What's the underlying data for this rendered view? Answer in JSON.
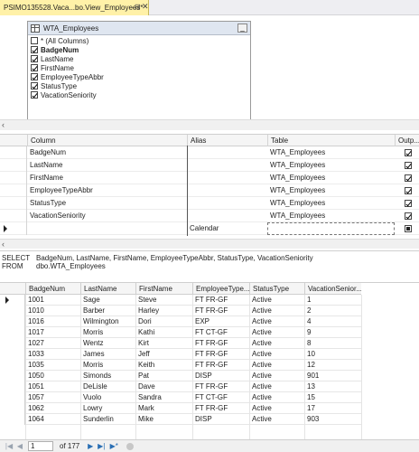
{
  "tab": {
    "title": "PSIMO135528.Vaca...bo.View_Employees*",
    "pin_icon": "pin-icon",
    "close_icon": "close-icon"
  },
  "diagram": {
    "table_name": "WTA_Employees",
    "columns": [
      {
        "label": "* (All Columns)",
        "checked": false,
        "bold": false
      },
      {
        "label": "BadgeNum",
        "checked": true,
        "bold": true
      },
      {
        "label": "LastName",
        "checked": true,
        "bold": false
      },
      {
        "label": "FirstName",
        "checked": true,
        "bold": false
      },
      {
        "label": "EmployeeTypeAbbr",
        "checked": true,
        "bold": false
      },
      {
        "label": "StatusType",
        "checked": true,
        "bold": false
      },
      {
        "label": "VacationSeniority",
        "checked": true,
        "bold": false
      }
    ],
    "minimize_label": "_"
  },
  "criteria": {
    "headers": {
      "column": "Column",
      "alias": "Alias",
      "table": "Table",
      "output": "Outp..."
    },
    "rows": [
      {
        "column": "BadgeNum",
        "alias": "",
        "table": "WTA_Employees",
        "output": true
      },
      {
        "column": "LastName",
        "alias": "",
        "table": "WTA_Employees",
        "output": true
      },
      {
        "column": "FirstName",
        "alias": "",
        "table": "WTA_Employees",
        "output": true
      },
      {
        "column": "EmployeeTypeAbbr",
        "alias": "",
        "table": "WTA_Employees",
        "output": true
      },
      {
        "column": "StatusType",
        "alias": "",
        "table": "WTA_Employees",
        "output": true
      },
      {
        "column": "VacationSeniority",
        "alias": "",
        "table": "WTA_Employees",
        "output": true
      }
    ],
    "edit_row": {
      "column": "",
      "alias": "Calendar",
      "table": ""
    }
  },
  "sql": {
    "select_kw": "SELECT",
    "select_cols": "BadgeNum, LastName, FirstName, EmployeeTypeAbbr, StatusType, VacationSeniority",
    "from_kw": "FROM",
    "from_table": "dbo.WTA_Employees"
  },
  "results": {
    "headers": [
      "BadgeNum",
      "LastName",
      "FirstName",
      "EmployeeType...",
      "StatusType",
      "VacationSenior..."
    ],
    "rows": [
      [
        "1001",
        "Sage",
        "Steve",
        "FT FR-GF",
        "Active",
        "1"
      ],
      [
        "1010",
        "Barber",
        "Harley",
        "FT FR-GF",
        "Active",
        "2"
      ],
      [
        "1016",
        "Wilmington",
        "Dori",
        "EXP",
        "Active",
        "4"
      ],
      [
        "1017",
        "Morris",
        "Kathi",
        "FT CT-GF",
        "Active",
        "9"
      ],
      [
        "1027",
        "Wentz",
        "Kirt",
        "FT FR-GF",
        "Active",
        "8"
      ],
      [
        "1033",
        "James",
        "Jeff",
        "FT FR-GF",
        "Active",
        "10"
      ],
      [
        "1035",
        "Morris",
        "Keith",
        "FT FR-GF",
        "Active",
        "12"
      ],
      [
        "1050",
        "Simonds",
        "Pat",
        "DISP",
        "Active",
        "901"
      ],
      [
        "1051",
        "DeLisle",
        "Dave",
        "FT FR-GF",
        "Active",
        "13"
      ],
      [
        "1057",
        "Vuolo",
        "Sandra",
        "FT CT-GF",
        "Active",
        "15"
      ],
      [
        "1062",
        "Lowry",
        "Mark",
        "FT FR-GF",
        "Active",
        "17"
      ],
      [
        "1064",
        "Sunderlin",
        "Mike",
        "DISP",
        "Active",
        "903"
      ]
    ]
  },
  "nav": {
    "first": "|◀",
    "prev": "◀",
    "current_page": "1",
    "of_label": "of 177",
    "next": "▶",
    "last": "▶|",
    "new": "▶*"
  }
}
